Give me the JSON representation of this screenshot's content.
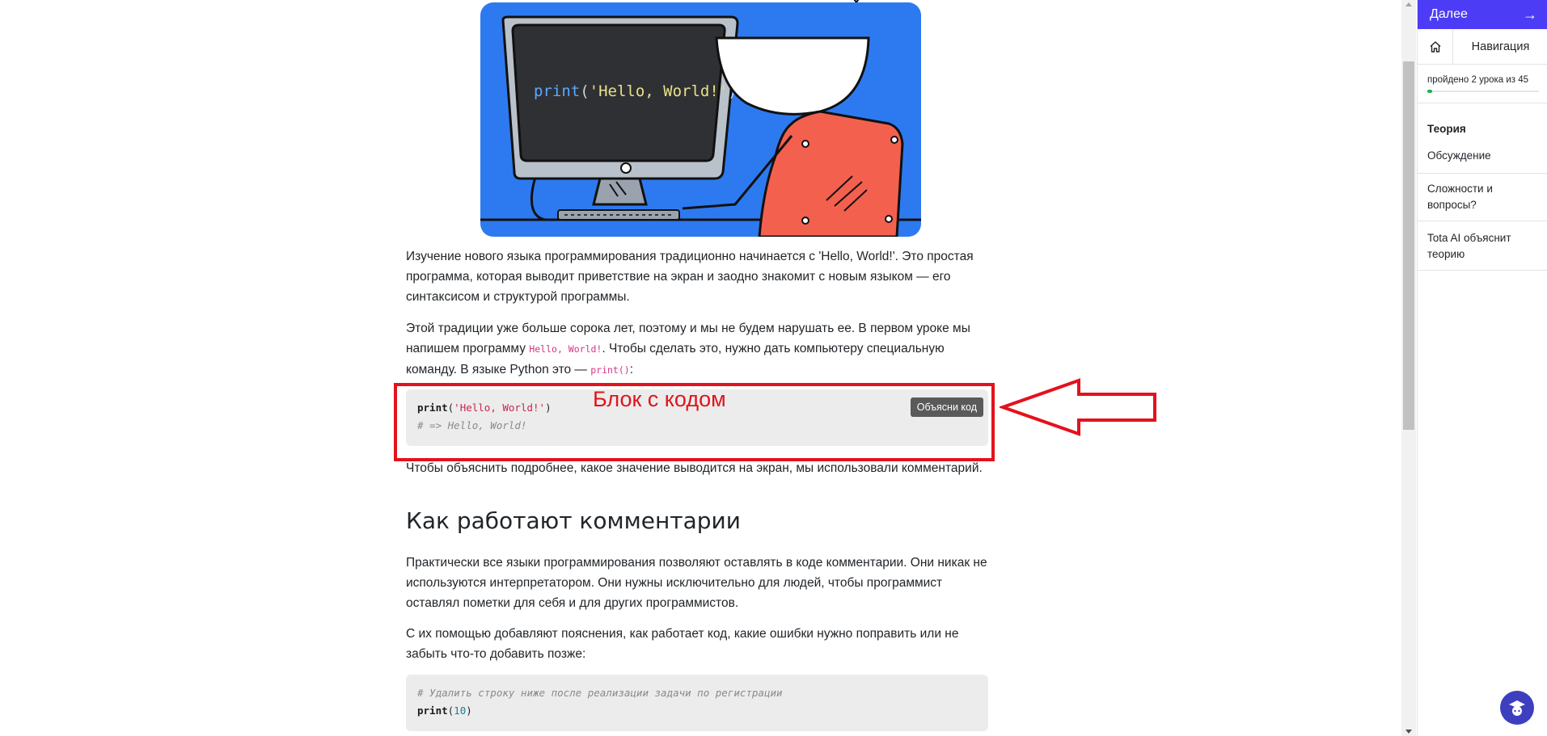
{
  "hero": {
    "stray_mark": "x",
    "screen_code": {
      "fn": "print",
      "open": "(",
      "arg": "'Hello, World!'",
      "close": ")"
    }
  },
  "article": {
    "p1": "Изучение нового языка программирования традиционно начинается с 'Hello, World!'. Это простая программа, которая выводит приветствие на экран и заодно знакомит с новым языком — его синтаксисом и структурой программы.",
    "p2_part1": "Этой традиции уже больше сорока лет, поэтому и мы не будем нарушать ее. В первом уроке мы напишем программу ",
    "p2_code1": "Hello, World!",
    "p2_part2": ". Чтобы сделать это, нужно дать компьютеру специальную команду. В языке Python это — ",
    "p2_code2": "print()",
    "p2_part3": ":",
    "code1": {
      "line1_fn": "print",
      "line1_open": "(",
      "line1_str": "'Hello, World!'",
      "line1_close": ")",
      "line2_comment": "# => Hello, World!",
      "explain_button": "Объясни код"
    },
    "p3": "Чтобы объяснить подробнее, какое значение выводится на экран, мы использовали комментарий.",
    "heading": "Как работают комментарии",
    "p4": "Практически все языки программирования позволяют оставлять в коде комментарии. Они никак не используются интерпретатором. Они нужны исключительно для людей, чтобы программист оставлял пометки для себя и для других программистов.",
    "p5": "С их помощью добавляют пояснения, как работает код, какие ошибки нужно поправить или не забыть что-то добавить позже:",
    "code2": {
      "line1_comment": "# Удалить строку ниже после реализации задачи по регистрации",
      "line2_fn": "print",
      "line2_open": "(",
      "line2_num": "10",
      "line2_close": ")"
    }
  },
  "annotation": {
    "label": "Блок с кодом",
    "color": "#e3121c"
  },
  "sidebar": {
    "next_label": "Далее",
    "next_arrow": "→",
    "nav_label": "Навигация",
    "home_icon": "home-icon",
    "progress_text": "пройдено 2 урока из 45",
    "progress_fraction": 0.044,
    "accent": "#4c3cf5",
    "progress_color": "#22b14c",
    "items": [
      {
        "label": "Теория",
        "active": true
      },
      {
        "label": "Обсуждение",
        "active": false
      },
      {
        "label": "Сложности и вопросы?",
        "active": false
      },
      {
        "label": "Tota AI объяснит теорию",
        "active": false
      }
    ],
    "bot_icon": "assistant-bot-icon"
  }
}
